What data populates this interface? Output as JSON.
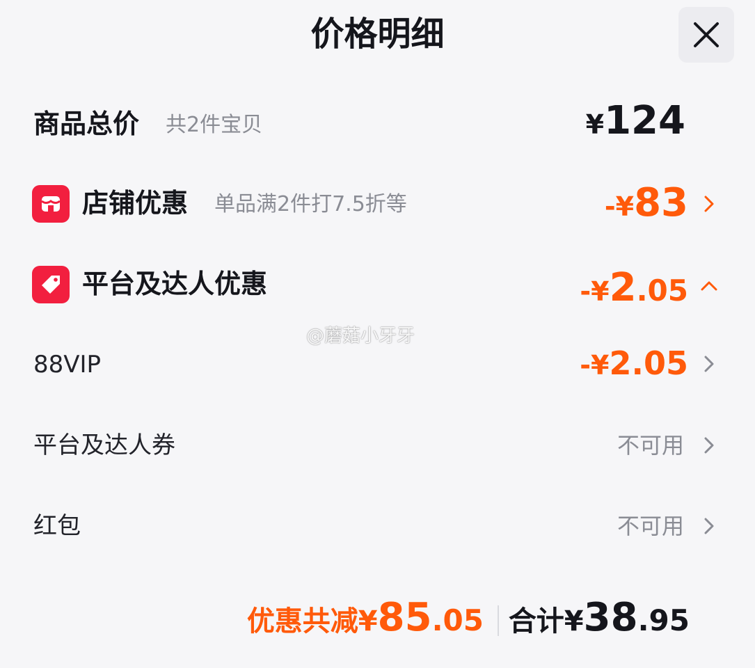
{
  "header": {
    "title": "价格明细",
    "close_icon": "close-icon"
  },
  "subtotal": {
    "label": "商品总价",
    "note": "共2件宝贝",
    "currency": "¥",
    "amount": "124"
  },
  "store_discount": {
    "icon": "store-icon",
    "label": "店铺优惠",
    "note": "单品满2件打7.5折等",
    "sign": "-¥",
    "amount_int": "83",
    "amount_dec": ""
  },
  "platform_discount": {
    "icon": "tag-icon",
    "label": "平台及达人优惠",
    "sign": "-¥",
    "amount_int": "2",
    "amount_dec": ".05",
    "expanded": true
  },
  "vip": {
    "label": "88VIP",
    "sign": "-¥",
    "amount_int": "2",
    "amount_dec": ".05"
  },
  "coupon": {
    "label": "平台及达人券",
    "value": "不可用"
  },
  "red_packet": {
    "label": "红包",
    "value": "不可用"
  },
  "footer": {
    "saving_label": "优惠共减¥",
    "saving_int": "85",
    "saving_dec": ".05",
    "total_label": "合计¥",
    "total_int": "38",
    "total_dec": ".95"
  },
  "watermark": "@蘑菇小牙牙",
  "colors": {
    "accent_orange": "#ff5a0a",
    "icon_red": "#f21f3f",
    "text_dark": "#15161c",
    "text_muted": "#8a8c94",
    "background": "#f6f6f8"
  }
}
